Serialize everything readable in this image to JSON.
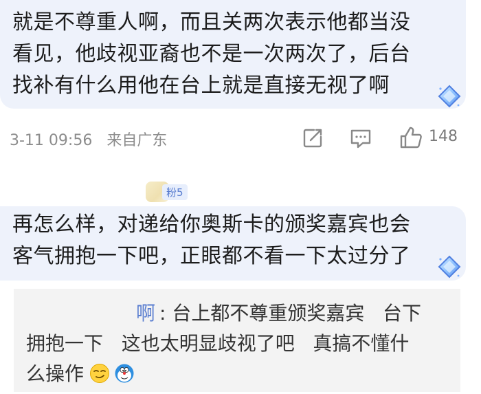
{
  "comment1": {
    "lines": [
      "就是不尊重人啊，而且关两次表示他都当没",
      "看见，他歧视亚裔也不是一次两次了，后台",
      "找补有什么用他在台上就是直接无视了啊"
    ],
    "time": "3-11 09:56",
    "location": "来自广东",
    "like_count": "148"
  },
  "comment2": {
    "fans_badge": "粉5",
    "lines": [
      "再怎么样，对递给你奥斯卡的颁奖嘉宾也会",
      "客气拥抱一下吧，正眼都不看一下太过分了"
    ]
  },
  "reply": {
    "name_tail": "啊",
    "line1": ": 台上都不尊重颁奖嘉宾   台下",
    "line2": "拥抱一下   这也太明显歧视了吧   真搞不懂什",
    "line3": "么操作"
  },
  "colors": {
    "bubble": "#eef2fb",
    "link_blue": "#5a7ed0",
    "meta_gray": "#8c8c8c",
    "reply_bg": "#f3f3f3"
  },
  "icons": {
    "share": "share-icon",
    "comment": "comment-icon",
    "like": "thumbs-up-icon",
    "diamond": "diamond-sticker-icon",
    "emoji_smirk": "smirk-emoji-icon",
    "emoji_doraemon": "doraemon-emoji-icon"
  }
}
